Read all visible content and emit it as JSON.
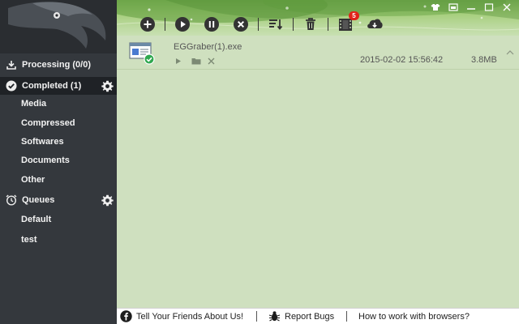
{
  "sidebar": {
    "processing": {
      "label": "Processing (0/0)"
    },
    "completed": {
      "label": "Completed (1)"
    },
    "categories": [
      {
        "label": "Media"
      },
      {
        "label": "Compressed"
      },
      {
        "label": "Softwares"
      },
      {
        "label": "Documents"
      },
      {
        "label": "Other"
      }
    ],
    "queues": {
      "label": "Queues"
    },
    "queue_items": [
      {
        "label": "Default"
      },
      {
        "label": "test"
      }
    ]
  },
  "toolbar": {
    "buttons": [
      {
        "icon": "add-icon"
      },
      {
        "icon": "play-icon"
      },
      {
        "icon": "pause-icon"
      },
      {
        "icon": "stop-icon"
      },
      {
        "icon": "sort-icon"
      },
      {
        "icon": "delete-icon"
      },
      {
        "icon": "video-icon",
        "badge": "5"
      },
      {
        "icon": "cloud-download-icon"
      }
    ]
  },
  "downloads": [
    {
      "name": "EGGraber(1).exe",
      "date": "2015-02-02 15:56:42",
      "size": "3.8MB"
    }
  ],
  "footer": {
    "tell_friends": "Tell Your Friends About Us!",
    "report_bugs": "Report Bugs",
    "browsers": "How to work with browsers?"
  },
  "colors": {
    "sidebar": "#34383d",
    "active": "#1f2226",
    "main_bg": "#cfe0bf",
    "badge": "#e2231a",
    "success": "#2fa84f"
  }
}
